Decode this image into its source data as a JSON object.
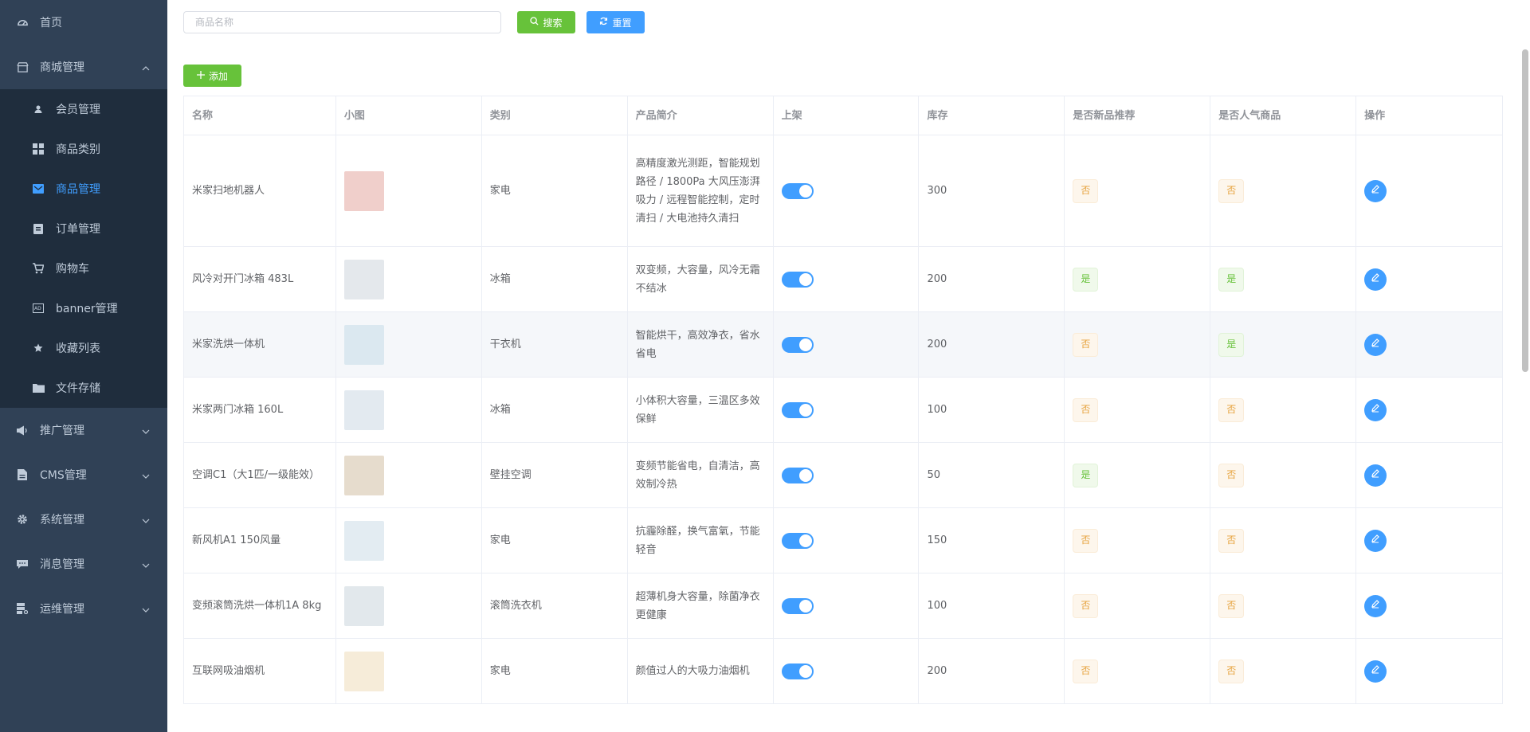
{
  "sidebar": {
    "home": "首页",
    "mall": "商城管理",
    "members": "会员管理",
    "categories": "商品类别",
    "products": "商品管理",
    "orders": "订单管理",
    "cart": "购物车",
    "banner": "banner管理",
    "favorites": "收藏列表",
    "files": "文件存储",
    "promo": "推广管理",
    "cms": "CMS管理",
    "system": "系统管理",
    "messages": "消息管理",
    "ops": "运维管理"
  },
  "search": {
    "placeholder": "商品名称",
    "search_label": "搜索",
    "reset_label": "重置"
  },
  "add_label": "添加",
  "table": {
    "headers": [
      "名称",
      "小图",
      "类别",
      "产品简介",
      "上架",
      "库存",
      "是否新品推荐",
      "是否人气商品",
      "操作"
    ],
    "rows": [
      {
        "name": "米家扫地机器人",
        "category": "家电",
        "desc": "高精度激光测距，智能规划路径 / 1800Pa 大风压澎湃吸力 / 远程智能控制，定时清扫 / 大电池持久清扫",
        "on_shelf": true,
        "stock": "300",
        "is_new": "否",
        "is_popular": "否",
        "thumb_color": "#f0cfcb"
      },
      {
        "name": "风冷对开门冰箱 483L",
        "category": "冰箱",
        "desc": "双变频，大容量，风冷无霜不结冰",
        "on_shelf": true,
        "stock": "200",
        "is_new": "是",
        "is_popular": "是",
        "thumb_color": "#e4e8ec"
      },
      {
        "name": "米家洗烘一体机",
        "category": "干衣机",
        "desc": "智能烘干，高效净衣，省水省电",
        "on_shelf": true,
        "stock": "200",
        "is_new": "否",
        "is_popular": "是",
        "thumb_color": "#dbe8f0"
      },
      {
        "name": "米家两门冰箱 160L",
        "category": "冰箱",
        "desc": "小体积大容量，三温区多效保鲜",
        "on_shelf": true,
        "stock": "100",
        "is_new": "否",
        "is_popular": "否",
        "thumb_color": "#e3eaf0"
      },
      {
        "name": "空调C1（大1匹/一级能效）",
        "category": "壁挂空调",
        "desc": "变频节能省电，自清洁，高效制冷热",
        "on_shelf": true,
        "stock": "50",
        "is_new": "是",
        "is_popular": "否",
        "thumb_color": "#e6dccd"
      },
      {
        "name": "新风机A1 150风量",
        "category": "家电",
        "desc": "抗霾除醛，换气富氧，节能轻音",
        "on_shelf": true,
        "stock": "150",
        "is_new": "否",
        "is_popular": "否",
        "thumb_color": "#e3ecf2"
      },
      {
        "name": "变频滚筒洗烘一体机1A 8kg",
        "category": "滚筒洗衣机",
        "desc": "超薄机身大容量，除菌净衣更健康",
        "on_shelf": true,
        "stock": "100",
        "is_new": "否",
        "is_popular": "否",
        "thumb_color": "#e2e8ec"
      },
      {
        "name": "互联网吸油烟机",
        "category": "家电",
        "desc": "颜值过人的大吸力油烟机",
        "on_shelf": true,
        "stock": "200",
        "is_new": "否",
        "is_popular": "否",
        "thumb_color": "#f6ecd9"
      }
    ]
  }
}
